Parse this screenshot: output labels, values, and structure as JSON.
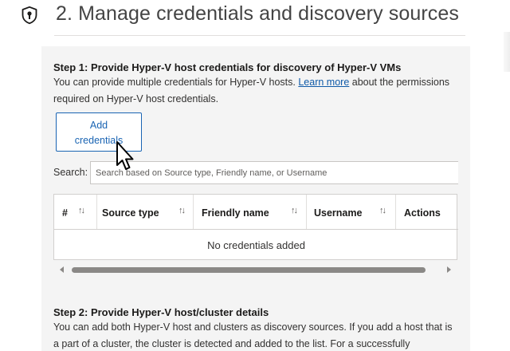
{
  "section": {
    "icon": "shield-key-icon",
    "title": "2. Manage credentials and discovery sources"
  },
  "step1": {
    "title": "Step 1: Provide Hyper-V host credentials for discovery of Hyper-V VMs",
    "desc_before_link": "You can provide multiple credentials for Hyper-V hosts. ",
    "link": "Learn more",
    "desc_after_link": " about the permissions",
    "desc_line2": "required on Hyper-V host credentials.",
    "add_button_line1": "Add",
    "add_button_line2": "credentials"
  },
  "search": {
    "label": "Search:",
    "placeholder": "Search based on Source type, Friendly name, or Username"
  },
  "table": {
    "columns": [
      {
        "label": "#",
        "sortable": true
      },
      {
        "label": "Source type",
        "sortable": true
      },
      {
        "label": "Friendly name",
        "sortable": true
      },
      {
        "label": "Username",
        "sortable": true
      },
      {
        "label": "Actions",
        "sortable": false
      }
    ],
    "sort_glyph": "↑↓",
    "empty_message": "No credentials added"
  },
  "step2": {
    "title": "Step 2: Provide Hyper-V host/cluster details",
    "desc_line1": "You can add both Hyper-V host and clusters as discovery sources. If you add a host that is",
    "desc_line2": "a part of a cluster, the cluster is detected and added to the list. For a successfully"
  },
  "colors": {
    "accent": "#1a64b3",
    "link": "#0f5aa8",
    "panel_background": "#f4f4f4",
    "border": "#d2d0ce"
  }
}
